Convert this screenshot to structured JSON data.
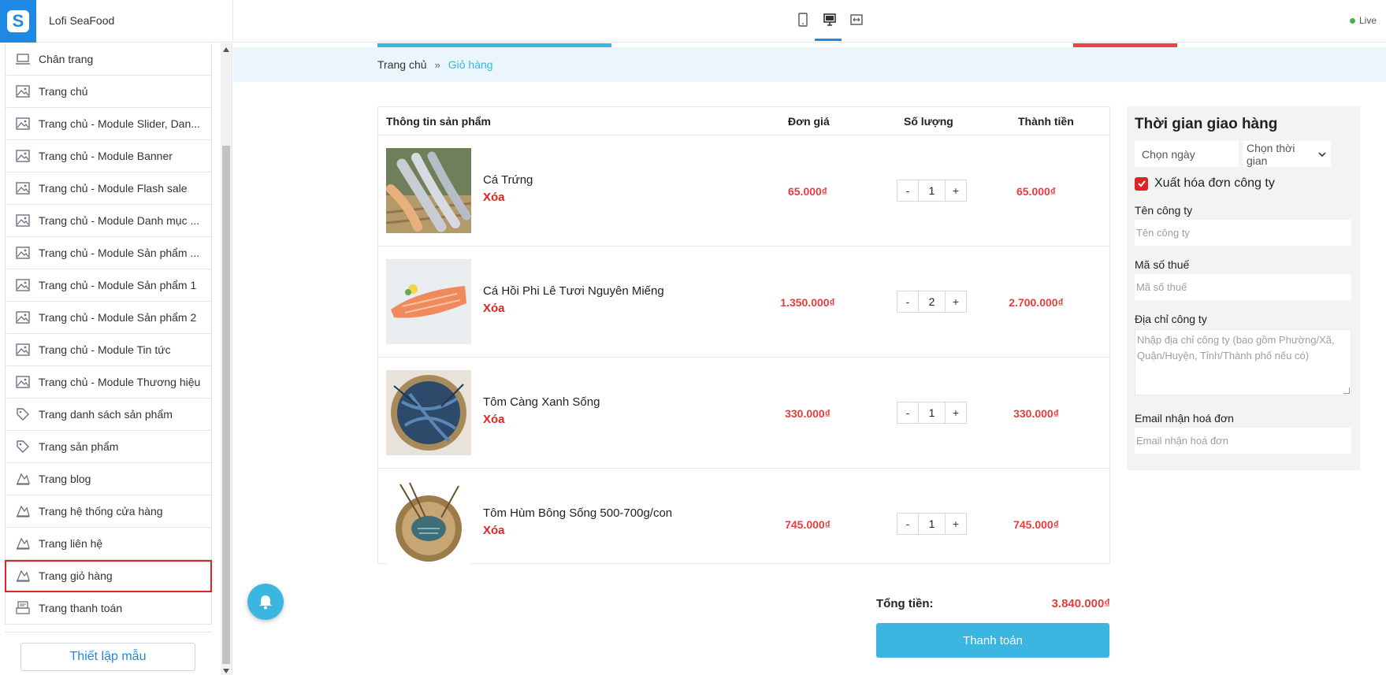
{
  "app": {
    "shop_name": "Lofi SeaFood",
    "status": "Live"
  },
  "sidebar": {
    "items": [
      {
        "label": "Chân trang",
        "icon": "laptop-icon"
      },
      {
        "label": "Trang chủ",
        "icon": "image-icon"
      },
      {
        "label": "Trang chủ - Module Slider, Dan...",
        "icon": "image-icon"
      },
      {
        "label": "Trang chủ - Module Banner",
        "icon": "image-icon"
      },
      {
        "label": "Trang chủ - Module Flash sale",
        "icon": "image-icon"
      },
      {
        "label": "Trang chủ - Module Danh mục ...",
        "icon": "image-icon"
      },
      {
        "label": "Trang chủ - Module Sản phẩm ...",
        "icon": "image-icon"
      },
      {
        "label": "Trang chủ - Module Sản phẩm 1",
        "icon": "image-icon"
      },
      {
        "label": "Trang chủ - Module Sản phẩm 2",
        "icon": "image-icon"
      },
      {
        "label": "Trang chủ - Module Tin tức",
        "icon": "image-icon"
      },
      {
        "label": "Trang chủ - Module Thương hiệu",
        "icon": "image-icon"
      },
      {
        "label": "Trang danh sách sản phẩm",
        "icon": "tag-icon"
      },
      {
        "label": "Trang sản phẩm",
        "icon": "tag-icon"
      },
      {
        "label": "Trang blog",
        "icon": "pages-icon"
      },
      {
        "label": "Trang hệ thống cửa hàng",
        "icon": "pages-icon"
      },
      {
        "label": "Trang liên hệ",
        "icon": "pages-icon"
      },
      {
        "label": "Trang giỏ hàng",
        "icon": "pages-icon",
        "active": true
      },
      {
        "label": "Trang thanh toán",
        "icon": "register-icon"
      }
    ],
    "setup_button": "Thiết lập mẫu"
  },
  "breadcrumb": {
    "home": "Trang chủ",
    "separator": "»",
    "current": "Giỏ hàng"
  },
  "cart": {
    "headers": {
      "info": "Thông tin sản phẩm",
      "price": "Đơn giá",
      "qty": "Số lượng",
      "total": "Thành tiền"
    },
    "items": [
      {
        "name": "Cá Trứng",
        "remove": "Xóa",
        "price": "65.000₫",
        "qty": "1",
        "total": "65.000₫"
      },
      {
        "name": "Cá Hồi Phi Lê Tươi Nguyên Miếng",
        "remove": "Xóa",
        "price": "1.350.000₫",
        "qty": "2",
        "total": "2.700.000₫"
      },
      {
        "name": "Tôm Càng Xanh Sống",
        "remove": "Xóa",
        "price": "330.000₫",
        "qty": "1",
        "total": "330.000₫"
      },
      {
        "name": "Tôm Hùm Bông Sống 500-700g/con",
        "remove": "Xóa",
        "price": "745.000₫",
        "qty": "1",
        "total": "745.000₫"
      }
    ],
    "minus": "-",
    "plus": "+",
    "sum_label": "Tổng tiền:",
    "sum_value": "3.840.000₫",
    "checkout": "Thanh toán"
  },
  "delivery": {
    "title": "Thời gian giao hàng",
    "date_placeholder": "Chọn ngày",
    "time_placeholder": "Chọn thời gian",
    "invoice_label": "Xuất hóa đơn công ty",
    "invoice_checked": true,
    "company_label": "Tên công ty",
    "company_placeholder": "Tên công ty",
    "tax_label": "Mã số thuế",
    "tax_placeholder": "Mã số thuế",
    "address_label": "Địa chỉ công ty",
    "address_placeholder": "Nhập địa chỉ công ty (bao gồm Phường/Xã, Quận/Huyện, Tỉnh/Thành phố nếu có)",
    "email_label": "Email nhận hoá đơn",
    "email_placeholder": "Email nhận hoá đơn"
  },
  "colors": {
    "accent": "#3bb6e0",
    "brand": "#1e88e5",
    "price": "#e53e3e",
    "active_outline": "#e02424"
  }
}
